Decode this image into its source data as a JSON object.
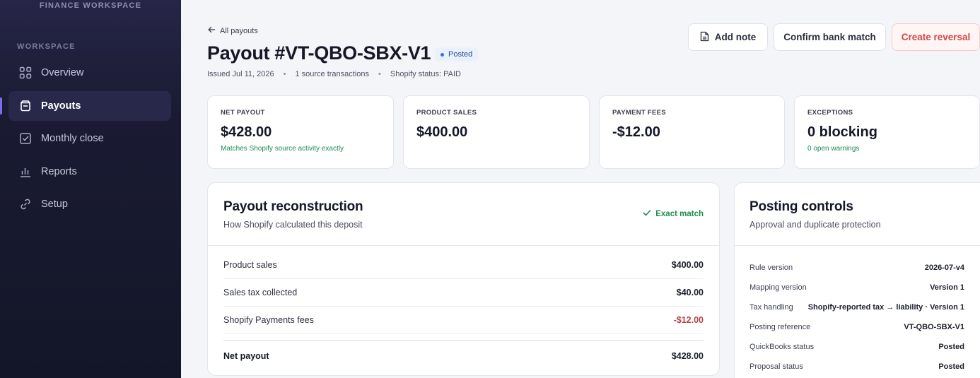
{
  "sidebar": {
    "brand": "FINANCE WORKSPACE",
    "section_label": "WORKSPACE",
    "items": [
      {
        "label": "Overview",
        "icon": "grid-icon"
      },
      {
        "label": "Payouts",
        "icon": "wallet-icon",
        "active": true
      },
      {
        "label": "Monthly close",
        "icon": "checkbox-icon"
      },
      {
        "label": "Reports",
        "icon": "bar-chart-icon"
      },
      {
        "label": "Setup",
        "icon": "link-icon"
      }
    ]
  },
  "header": {
    "back_label": "All payouts",
    "title": "Payout #VT-QBO-SBX-V1",
    "status": "Posted",
    "meta": [
      "Issued Jul 11, 2026",
      "1 source transactions",
      "Shopify status: PAID"
    ],
    "actions": {
      "add_note": "Add note",
      "confirm": "Confirm bank match",
      "reverse": "Create reversal"
    }
  },
  "stats": [
    {
      "label": "NET PAYOUT",
      "value": "$428.00",
      "sub": "Matches Shopify source activity exactly"
    },
    {
      "label": "PRODUCT SALES",
      "value": "$400.00",
      "sub": ""
    },
    {
      "label": "PAYMENT FEES",
      "value": "-$12.00",
      "sub": ""
    },
    {
      "label": "EXCEPTIONS",
      "value": "0 blocking",
      "sub": "0 open warnings"
    }
  ],
  "reconstruction": {
    "title": "Payout reconstruction",
    "subtitle": "How Shopify calculated this deposit",
    "match_label": "Exact match",
    "rows": [
      {
        "label": "Product sales",
        "amount": "$400.00"
      },
      {
        "label": "Sales tax collected",
        "amount": "$40.00"
      },
      {
        "label": "Shopify Payments fees",
        "amount": "-$12.00"
      }
    ],
    "total": {
      "label": "Net payout",
      "amount": "$428.00"
    }
  },
  "controls": {
    "title": "Posting controls",
    "subtitle": "Approval and duplicate protection",
    "rows": [
      {
        "label": "Rule version",
        "value": "2026-07-v4"
      },
      {
        "label": "Mapping version",
        "value": "Version 1"
      },
      {
        "label": "Tax handling",
        "value": "Shopify-reported tax → liability · Version 1"
      },
      {
        "label": "Posting reference",
        "value": "VT-QBO-SBX-V1"
      },
      {
        "label": "QuickBooks status",
        "value": "Posted"
      },
      {
        "label": "Proposal status",
        "value": "Posted"
      }
    ]
  },
  "colors": {
    "accent": "#7c6cf0",
    "success": "#1f8a55",
    "danger": "#d54545",
    "sidebar": "#1a1b33"
  }
}
